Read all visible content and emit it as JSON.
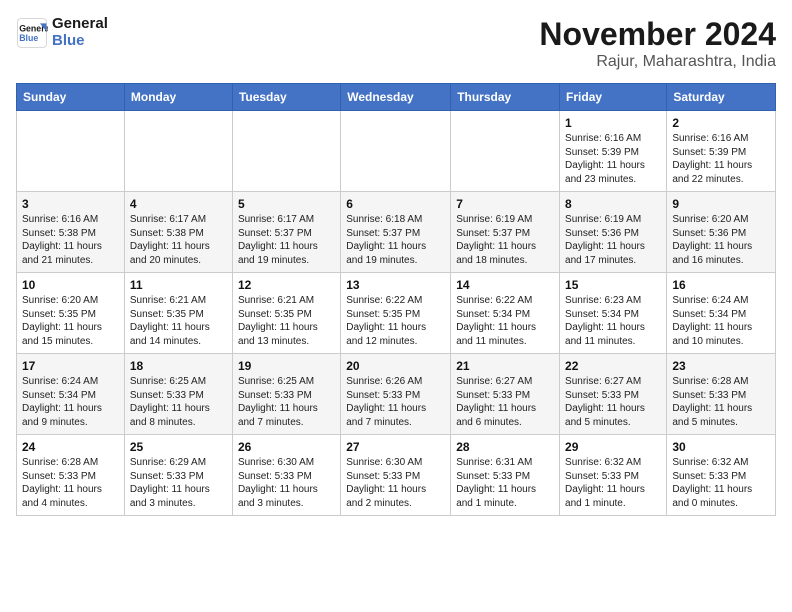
{
  "header": {
    "logo_line1": "General",
    "logo_line2": "Blue",
    "month_title": "November 2024",
    "location": "Rajur, Maharashtra, India"
  },
  "weekdays": [
    "Sunday",
    "Monday",
    "Tuesday",
    "Wednesday",
    "Thursday",
    "Friday",
    "Saturday"
  ],
  "weeks": [
    [
      {
        "day": "",
        "info": ""
      },
      {
        "day": "",
        "info": ""
      },
      {
        "day": "",
        "info": ""
      },
      {
        "day": "",
        "info": ""
      },
      {
        "day": "",
        "info": ""
      },
      {
        "day": "1",
        "info": "Sunrise: 6:16 AM\nSunset: 5:39 PM\nDaylight: 11 hours\nand 23 minutes."
      },
      {
        "day": "2",
        "info": "Sunrise: 6:16 AM\nSunset: 5:39 PM\nDaylight: 11 hours\nand 22 minutes."
      }
    ],
    [
      {
        "day": "3",
        "info": "Sunrise: 6:16 AM\nSunset: 5:38 PM\nDaylight: 11 hours\nand 21 minutes."
      },
      {
        "day": "4",
        "info": "Sunrise: 6:17 AM\nSunset: 5:38 PM\nDaylight: 11 hours\nand 20 minutes."
      },
      {
        "day": "5",
        "info": "Sunrise: 6:17 AM\nSunset: 5:37 PM\nDaylight: 11 hours\nand 19 minutes."
      },
      {
        "day": "6",
        "info": "Sunrise: 6:18 AM\nSunset: 5:37 PM\nDaylight: 11 hours\nand 19 minutes."
      },
      {
        "day": "7",
        "info": "Sunrise: 6:19 AM\nSunset: 5:37 PM\nDaylight: 11 hours\nand 18 minutes."
      },
      {
        "day": "8",
        "info": "Sunrise: 6:19 AM\nSunset: 5:36 PM\nDaylight: 11 hours\nand 17 minutes."
      },
      {
        "day": "9",
        "info": "Sunrise: 6:20 AM\nSunset: 5:36 PM\nDaylight: 11 hours\nand 16 minutes."
      }
    ],
    [
      {
        "day": "10",
        "info": "Sunrise: 6:20 AM\nSunset: 5:35 PM\nDaylight: 11 hours\nand 15 minutes."
      },
      {
        "day": "11",
        "info": "Sunrise: 6:21 AM\nSunset: 5:35 PM\nDaylight: 11 hours\nand 14 minutes."
      },
      {
        "day": "12",
        "info": "Sunrise: 6:21 AM\nSunset: 5:35 PM\nDaylight: 11 hours\nand 13 minutes."
      },
      {
        "day": "13",
        "info": "Sunrise: 6:22 AM\nSunset: 5:35 PM\nDaylight: 11 hours\nand 12 minutes."
      },
      {
        "day": "14",
        "info": "Sunrise: 6:22 AM\nSunset: 5:34 PM\nDaylight: 11 hours\nand 11 minutes."
      },
      {
        "day": "15",
        "info": "Sunrise: 6:23 AM\nSunset: 5:34 PM\nDaylight: 11 hours\nand 11 minutes."
      },
      {
        "day": "16",
        "info": "Sunrise: 6:24 AM\nSunset: 5:34 PM\nDaylight: 11 hours\nand 10 minutes."
      }
    ],
    [
      {
        "day": "17",
        "info": "Sunrise: 6:24 AM\nSunset: 5:34 PM\nDaylight: 11 hours\nand 9 minutes."
      },
      {
        "day": "18",
        "info": "Sunrise: 6:25 AM\nSunset: 5:33 PM\nDaylight: 11 hours\nand 8 minutes."
      },
      {
        "day": "19",
        "info": "Sunrise: 6:25 AM\nSunset: 5:33 PM\nDaylight: 11 hours\nand 7 minutes."
      },
      {
        "day": "20",
        "info": "Sunrise: 6:26 AM\nSunset: 5:33 PM\nDaylight: 11 hours\nand 7 minutes."
      },
      {
        "day": "21",
        "info": "Sunrise: 6:27 AM\nSunset: 5:33 PM\nDaylight: 11 hours\nand 6 minutes."
      },
      {
        "day": "22",
        "info": "Sunrise: 6:27 AM\nSunset: 5:33 PM\nDaylight: 11 hours\nand 5 minutes."
      },
      {
        "day": "23",
        "info": "Sunrise: 6:28 AM\nSunset: 5:33 PM\nDaylight: 11 hours\nand 5 minutes."
      }
    ],
    [
      {
        "day": "24",
        "info": "Sunrise: 6:28 AM\nSunset: 5:33 PM\nDaylight: 11 hours\nand 4 minutes."
      },
      {
        "day": "25",
        "info": "Sunrise: 6:29 AM\nSunset: 5:33 PM\nDaylight: 11 hours\nand 3 minutes."
      },
      {
        "day": "26",
        "info": "Sunrise: 6:30 AM\nSunset: 5:33 PM\nDaylight: 11 hours\nand 3 minutes."
      },
      {
        "day": "27",
        "info": "Sunrise: 6:30 AM\nSunset: 5:33 PM\nDaylight: 11 hours\nand 2 minutes."
      },
      {
        "day": "28",
        "info": "Sunrise: 6:31 AM\nSunset: 5:33 PM\nDaylight: 11 hours\nand 1 minute."
      },
      {
        "day": "29",
        "info": "Sunrise: 6:32 AM\nSunset: 5:33 PM\nDaylight: 11 hours\nand 1 minute."
      },
      {
        "day": "30",
        "info": "Sunrise: 6:32 AM\nSunset: 5:33 PM\nDaylight: 11 hours\nand 0 minutes."
      }
    ]
  ]
}
